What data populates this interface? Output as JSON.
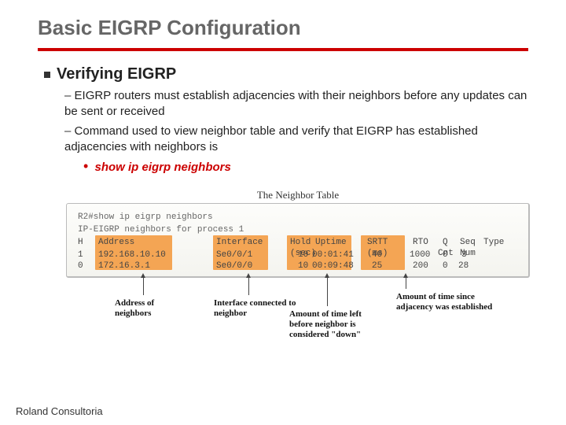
{
  "title": "Basic EIGRP Configuration",
  "section_heading": "Verifying EIGRP",
  "bullets": {
    "b1": "EIGRP routers must establish adjacencies with their neighbors before any updates can be sent or received",
    "b2": "Command used to view neighbor table and verify that EIGRP has established adjacencies with neighbors is",
    "cmd": "show ip eigrp neighbors"
  },
  "figure": {
    "title": "The Neighbor Table",
    "lines": {
      "l1": "R2#show ip eigrp neighbors",
      "l2": "IP-EIGRP neighbors for process 1",
      "l3a": "H",
      "l3b": "Address",
      "l3c": "Interface",
      "l3d": "Hold",
      "l3d2": "(sec)",
      "l3e": "Uptime",
      "l3f": "SRTT",
      "l3f2": "(ms)",
      "l3g": "RTO",
      "l3h": "Q",
      "l3h2": "Cnt",
      "l3i": "Seq",
      "l3i2": "Num",
      "l3j": "Type",
      "r1a": "1",
      "r1b": "192.168.10.10",
      "r1c": "Se0/0/1",
      "r1d": "10",
      "r1e": "00:01:41",
      "r1f": "40",
      "r1g": "1000",
      "r1h": "0",
      "r1i": "3",
      "r2a": "0",
      "r2b": "172.16.3.1",
      "r2c": "Se0/0/0",
      "r2d": "10",
      "r2e": "00:09:48",
      "r2f": "25",
      "r2g": "200",
      "r2h": "0",
      "r2i": "28"
    },
    "callouts": {
      "c1": "Address of neighbors",
      "c2": "Interface connected to neighbor",
      "c3": "Amount of time left before neighbor is considered \"down\"",
      "c4": "Amount of time since adjacency was established"
    }
  },
  "footer": "Roland Consultoria"
}
